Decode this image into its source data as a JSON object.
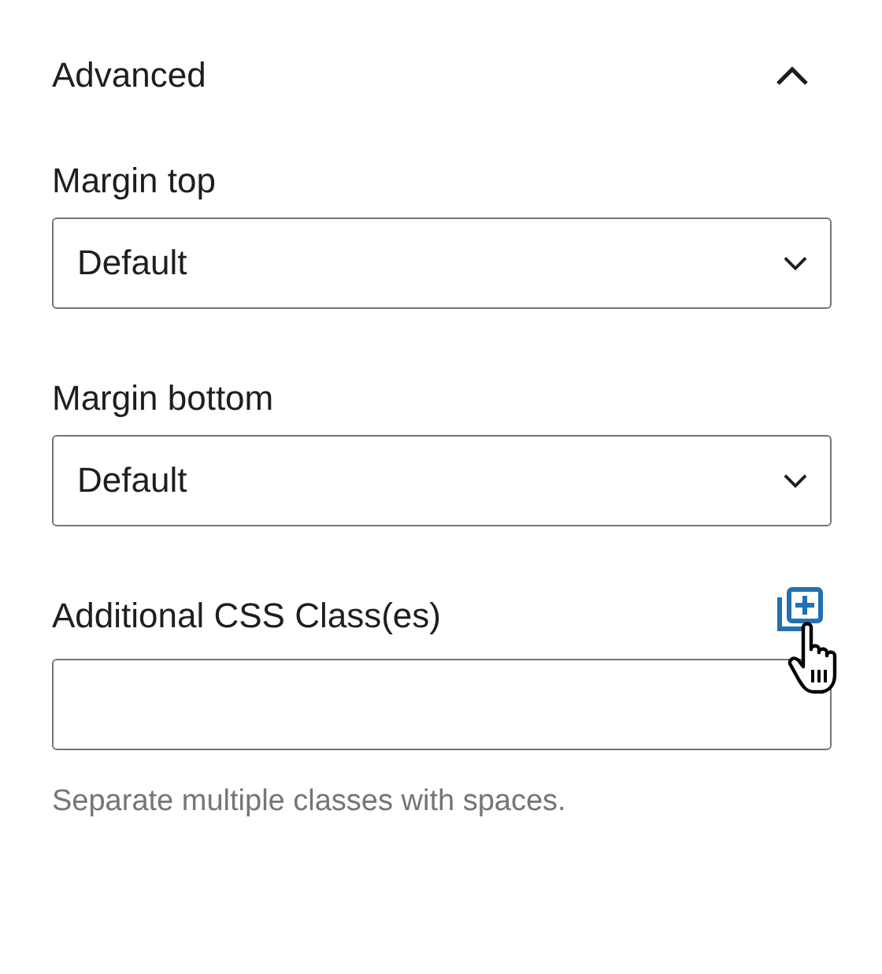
{
  "panel": {
    "title": "Advanced",
    "expanded": true,
    "fields": [
      {
        "kind": "select",
        "label": "Margin top",
        "value": "Default"
      },
      {
        "kind": "select",
        "label": "Margin bottom",
        "value": "Default"
      },
      {
        "kind": "text",
        "label": "Additional CSS Class(es)",
        "action_icon": true,
        "help": "Separate multiple classes with spaces."
      }
    ]
  }
}
